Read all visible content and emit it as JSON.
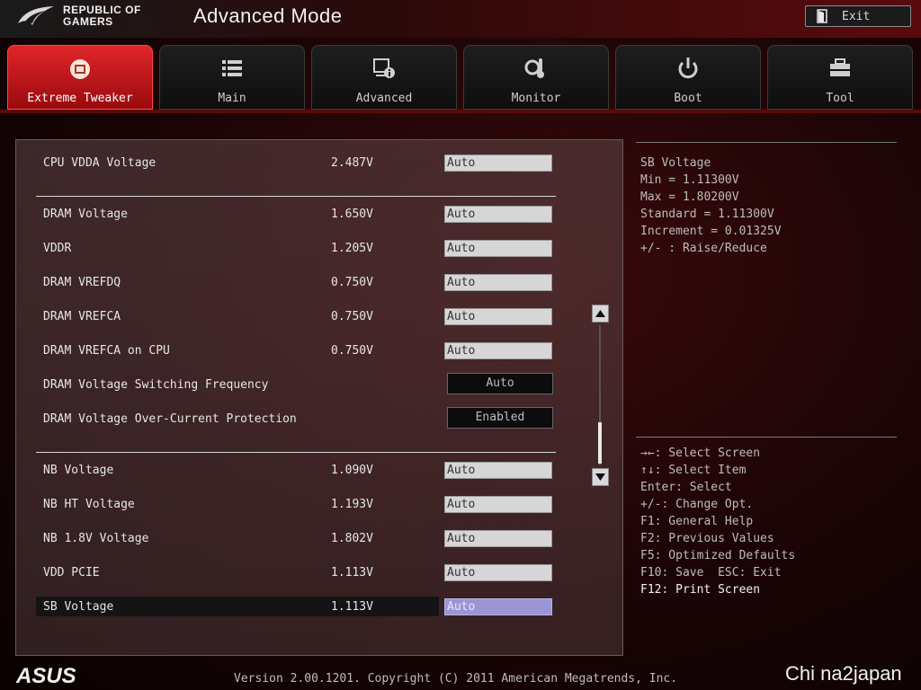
{
  "header": {
    "brand_line1": "REPUBLIC OF",
    "brand_line2": "GAMERS",
    "mode_title": "Advanced Mode",
    "exit_label": "Exit"
  },
  "tabs": [
    {
      "label": "Extreme Tweaker",
      "icon": "tweaker-icon",
      "active": true
    },
    {
      "label": "Main",
      "icon": "list-icon",
      "active": false
    },
    {
      "label": "Advanced",
      "icon": "advanced-info-icon",
      "active": false
    },
    {
      "label": "Monitor",
      "icon": "monitor-thermometer-icon",
      "active": false
    },
    {
      "label": "Boot",
      "icon": "power-icon",
      "active": false
    },
    {
      "label": "Tool",
      "icon": "toolbox-icon",
      "active": false
    }
  ],
  "settings": [
    {
      "label": "CPU VDDA Voltage",
      "value": "2.487V",
      "setting": "Auto"
    },
    {
      "label": "DRAM Voltage",
      "value": "1.650V",
      "setting": "Auto"
    },
    {
      "label": "VDDR",
      "value": "1.205V",
      "setting": "Auto"
    },
    {
      "label": "DRAM VREFDQ",
      "value": "0.750V",
      "setting": "Auto"
    },
    {
      "label": "DRAM VREFCA",
      "value": "0.750V",
      "setting": "Auto"
    },
    {
      "label": "DRAM VREFCA on CPU",
      "value": "0.750V",
      "setting": "Auto"
    },
    {
      "label": "DRAM Voltage Switching Frequency",
      "value": "",
      "setting": "Auto"
    },
    {
      "label": "DRAM Voltage Over-Current Protection",
      "value": "",
      "setting": "Enabled"
    },
    {
      "label": "NB Voltage",
      "value": "1.090V",
      "setting": "Auto"
    },
    {
      "label": "NB HT Voltage",
      "value": "1.193V",
      "setting": "Auto"
    },
    {
      "label": "NB 1.8V Voltage",
      "value": "1.802V",
      "setting": "Auto"
    },
    {
      "label": "VDD PCIE",
      "value": "1.113V",
      "setting": "Auto"
    },
    {
      "label": "SB Voltage",
      "value": "1.113V",
      "setting": "Auto"
    }
  ],
  "help": {
    "title": "SB Voltage",
    "min": "Min = 1.11300V",
    "max": "Max = 1.80200V",
    "standard": "Standard = 1.11300V",
    "increment": "Increment = 0.01325V",
    "raise": "+/- : Raise/Reduce"
  },
  "keys": [
    "→←: Select Screen",
    "↑↓: Select Item",
    "Enter: Select",
    "+/-: Change Opt.",
    "F1: General Help",
    "F2: Previous Values",
    "F5: Optimized Defaults",
    "F10: Save  ESC: Exit",
    "F12: Print Screen"
  ],
  "footer": {
    "version": "Version 2.00.1201. Copyright (C) 2011 American Megatrends, Inc.",
    "brand": "ASUS",
    "watermark": "Chi na2japan"
  },
  "colors": {
    "accent_red": "#e0262a",
    "selected_field": "#9a96d6"
  }
}
